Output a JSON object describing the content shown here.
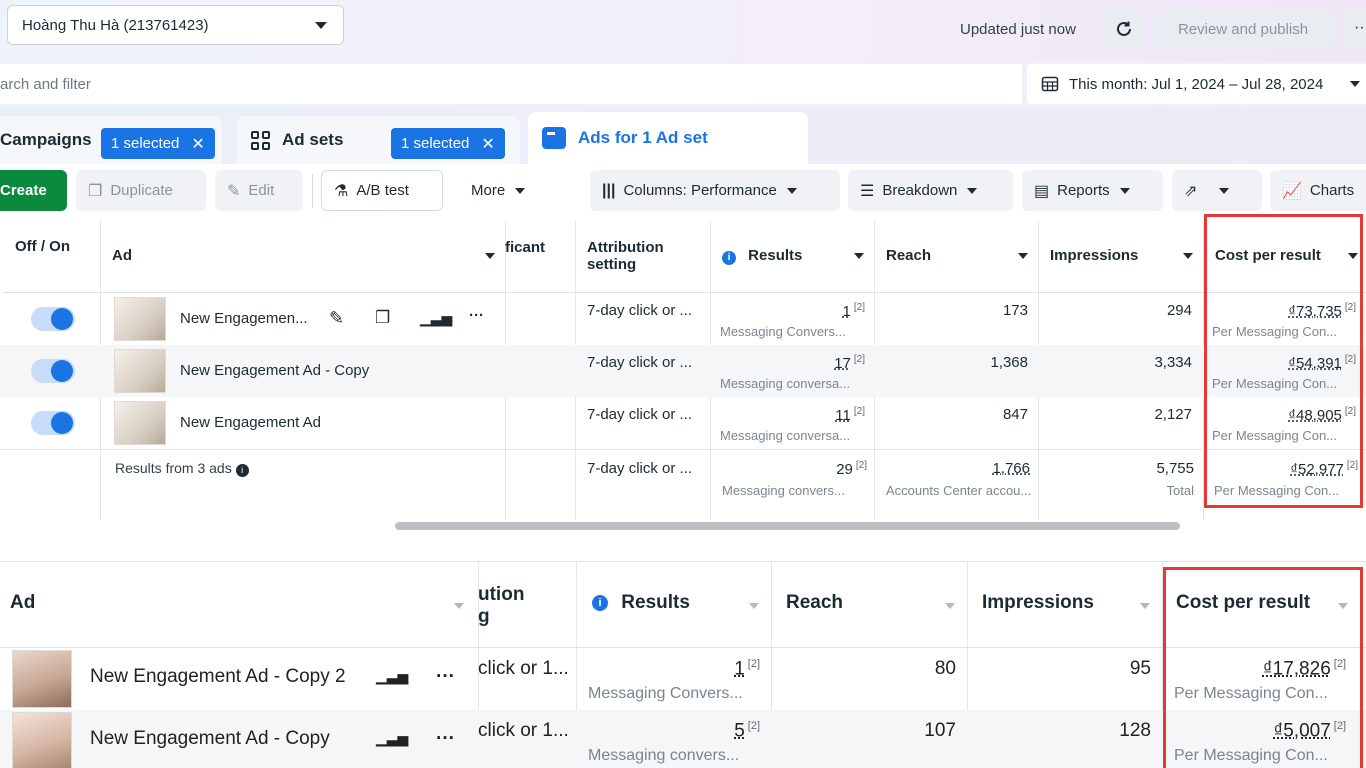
{
  "topbar": {
    "account": "Hoàng Thu Hà (213761423)",
    "updated": "Updated just now",
    "review_publish": "Review and publish",
    "more": "···"
  },
  "search": {
    "placeholder": "arch and filter"
  },
  "date_range": {
    "label": "This month: Jul 1, 2024 – Jul 28, 2024"
  },
  "tabs": {
    "campaigns": {
      "label": "Campaigns",
      "chip": "1 selected"
    },
    "adsets": {
      "label": "Ad sets",
      "chip": "1 selected"
    },
    "ads": {
      "label": "Ads for 1 Ad set"
    }
  },
  "toolbar": {
    "create": "Create",
    "duplicate": "Duplicate",
    "edit": "Edit",
    "ab_test": "A/B test",
    "more": "More",
    "columns": "Columns: Performance",
    "breakdown": "Breakdown",
    "reports": "Reports",
    "charts": "Charts"
  },
  "top_table": {
    "headers": {
      "off_on": "Off / On",
      "ad": "Ad",
      "partial": "ficant",
      "attribution": "Attribution setting",
      "results": "Results",
      "reach": "Reach",
      "impressions": "Impressions",
      "cost_per_result": "Cost per result"
    },
    "rows": [
      {
        "name": "New Engagemen...",
        "attribution": "7-day click or ...",
        "results": "1",
        "results_sub": "Messaging Convers...",
        "reach": "173",
        "impressions": "294",
        "cost": "₫73,735",
        "cost_sub": "Per Messaging Con..."
      },
      {
        "name": "New Engagement Ad - Copy",
        "attribution": "7-day click or ...",
        "results": "17",
        "results_sub": "Messaging conversa...",
        "reach": "1,368",
        "impressions": "3,334",
        "cost": "₫54,391",
        "cost_sub": "Per Messaging Con..."
      },
      {
        "name": "New Engagement Ad",
        "attribution": "7-day click or ...",
        "results": "11",
        "results_sub": "Messaging conversa...",
        "reach": "847",
        "impressions": "2,127",
        "cost": "₫48,905",
        "cost_sub": "Per Messaging Con..."
      }
    ],
    "summary": {
      "label": "Results from 3 ads",
      "attribution": "7-day click or ...",
      "results": "29",
      "results_sub": "Messaging convers...",
      "reach": "1,766",
      "reach_sub": "Accounts Center accou...",
      "impressions": "5,755",
      "impressions_sub": "Total",
      "cost": "₫52,977",
      "cost_sub": "Per Messaging Con..."
    },
    "footnote": "[2]"
  },
  "bottom_table": {
    "headers": {
      "ad": "Ad",
      "partial_line1": "ution",
      "partial_line2": "g",
      "results": "Results",
      "reach": "Reach",
      "impressions": "Impressions",
      "cost_per_result": "Cost per result"
    },
    "rows": [
      {
        "name": "New Engagement Ad - Copy 2",
        "attribution": "click or 1...",
        "results": "1",
        "results_sub": "Messaging Convers...",
        "reach": "80",
        "impressions": "95",
        "cost": "₫17,826",
        "cost_sub": "Per Messaging Con..."
      },
      {
        "name": "New Engagement Ad - Copy",
        "attribution": "click or 1...",
        "results": "5",
        "results_sub": "Messaging convers...",
        "reach": "107",
        "impressions": "128",
        "cost": "₫5,007",
        "cost_sub": "Per Messaging Con..."
      }
    ]
  },
  "colors": {
    "accent": "#1b74e4",
    "create_green": "#0b8a3e",
    "highlight_red": "#e53935"
  }
}
